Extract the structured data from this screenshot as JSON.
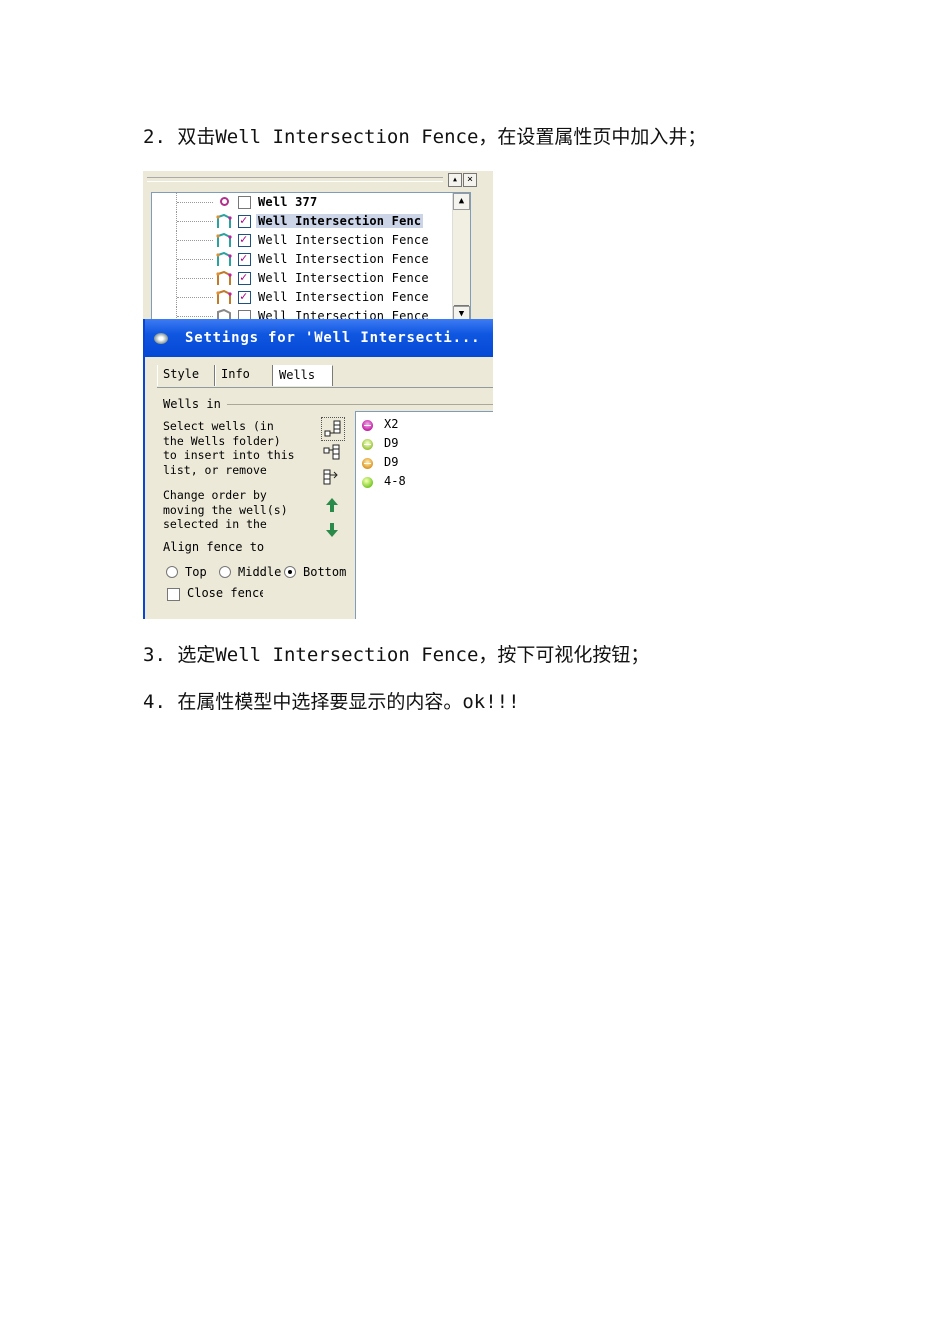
{
  "doc": {
    "step2": "2. 双击Well Intersection Fence，在设置属性页中加入井；",
    "step3": "3. 选定Well Intersection Fence，按下可视化按钮；",
    "step4": "4. 在属性模型中选择要显示的内容。ok!!!"
  },
  "screenshot": {
    "tree": {
      "items": [
        {
          "label": "Well 377",
          "icon": "well-circle-icon",
          "checked": false,
          "bold": true
        },
        {
          "label": "Well Intersection Fenc",
          "icon": "fence-icon",
          "checked": true,
          "bold": true,
          "selected": true
        },
        {
          "label": "Well Intersection Fence",
          "icon": "fence-icon",
          "checked": true
        },
        {
          "label": "Well Intersection Fence",
          "icon": "fence-icon",
          "checked": true
        },
        {
          "label": "Well Intersection Fence",
          "icon": "fence-icon",
          "checked": true
        },
        {
          "label": "Well Intersection Fence",
          "icon": "fence-icon",
          "checked": true
        },
        {
          "label": "Well Intersection Fence",
          "icon": "fence-icon",
          "checked": false
        }
      ]
    },
    "dialog": {
      "title": "Settings for 'Well Intersecti...",
      "tabs": [
        "Style",
        "Info",
        "Wells"
      ],
      "active_tab": "Wells",
      "section_title": "Wells in",
      "desc_insert": "Select wells (in\nthe Wells folder)\nto insert into this\nlist, or remove",
      "desc_order": "Change order by\nmoving the well(s)\nselected in the\nli..",
      "wells": [
        {
          "name": "X2",
          "color": "#c0209e"
        },
        {
          "name": "D9",
          "color": "#9ac43a"
        },
        {
          "name": "D9",
          "color": "#d9962a"
        },
        {
          "name": "4-8",
          "color": "#7ac82a"
        }
      ],
      "align_title": "Align fence to",
      "align_options": [
        "Top",
        "Middle",
        "Bottom"
      ],
      "align_selected": "Bottom",
      "close_fence_label": "Close fence"
    }
  }
}
